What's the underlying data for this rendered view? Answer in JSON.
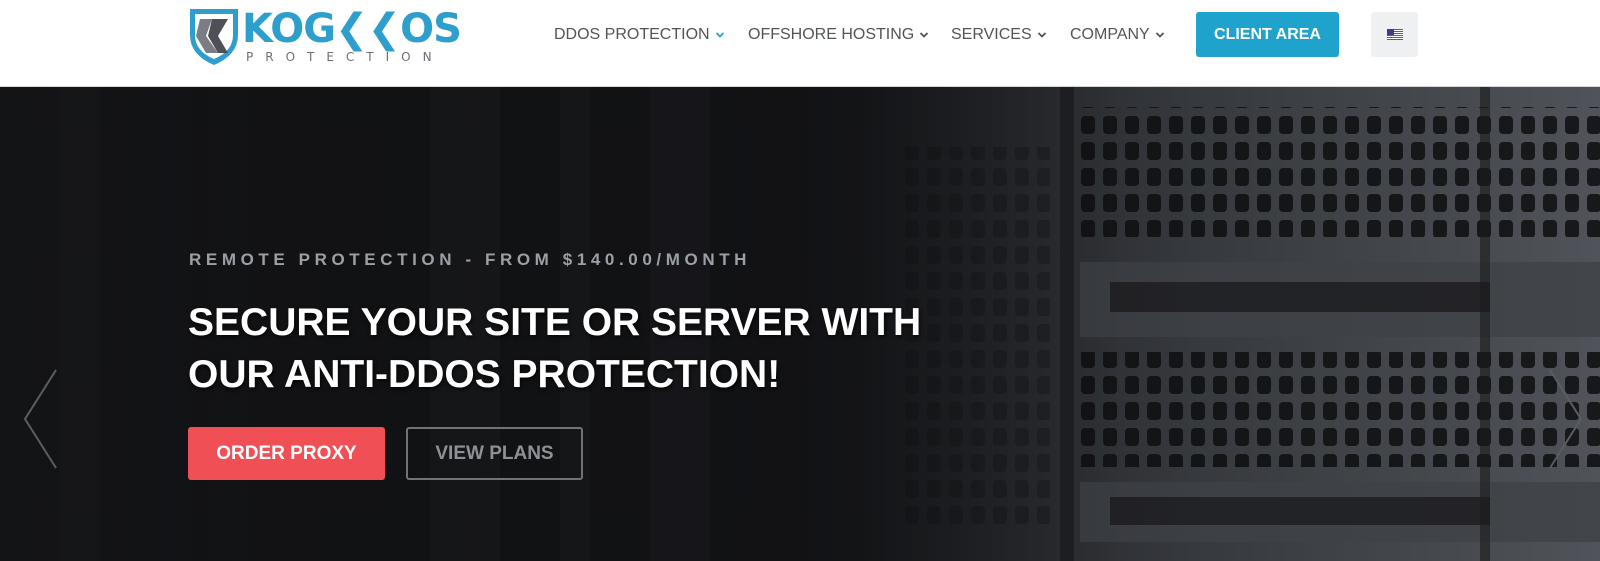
{
  "logo": {
    "word_start": "KOG",
    "word_end": "OS",
    "tagline": "PROTECTION",
    "brand_color": "#2e9fcc"
  },
  "nav": {
    "items": [
      {
        "label": "DDOS PROTECTION",
        "icon": "chevron-down-icon",
        "chevron_color": "#1fa3cc"
      },
      {
        "label": "OFFSHORE HOSTING",
        "icon": "chevron-down-icon",
        "chevron_color": "#505558"
      },
      {
        "label": "SERVICES",
        "icon": "chevron-down-icon",
        "chevron_color": "#505558"
      },
      {
        "label": "COMPANY",
        "icon": "chevron-down-icon",
        "chevron_color": "#505558"
      }
    ],
    "client_area_label": "CLIENT AREA",
    "language_icon": "us-flag-icon"
  },
  "hero": {
    "eyebrow": "REMOTE PROTECTION - FROM $140.00/MONTH",
    "headline_line1": "SECURE YOUR SITE OR SERVER WITH",
    "headline_line2": "OUR ANTI-DDOS PROTECTION!",
    "primary_button": "ORDER PROXY",
    "secondary_button": "VIEW PLANS",
    "prev_icon": "chevron-left-icon",
    "next_icon": "chevron-right-icon"
  },
  "colors": {
    "accent": "#1fa3cc",
    "order_button": "#ef4f55",
    "nav_text": "#505558"
  }
}
